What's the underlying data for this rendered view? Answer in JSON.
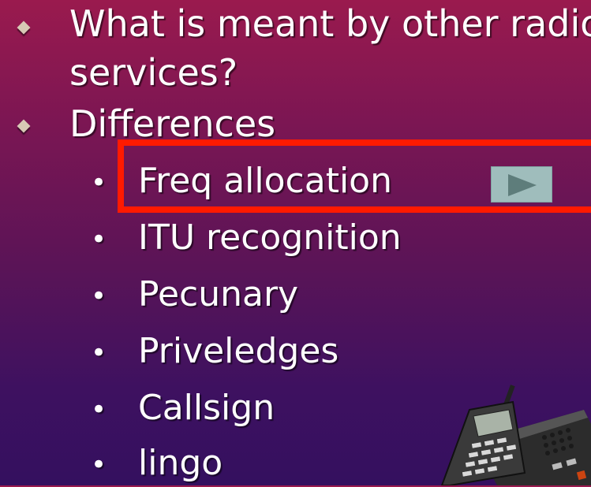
{
  "slide": {
    "bullets": [
      {
        "line1": "What is meant by other radio",
        "line2": "services?"
      },
      {
        "line1": "Differences"
      }
    ],
    "sub_bullets": [
      "Freq allocation",
      "ITU recognition",
      "Pecunary",
      "Priveledges",
      "Callsign",
      "lingo"
    ],
    "highlighted_item": "Freq allocation"
  },
  "colors": {
    "background_top": "#9a1a4e",
    "background_bottom": "#34105f",
    "highlight_border": "#ff1a00",
    "text": "#ffffff",
    "bullet_diamond": "#d7c9b5",
    "play_button": "#9fbdbc"
  },
  "icons": {
    "action_button": "play-icon",
    "clipart": "cordless-phone-icon"
  }
}
